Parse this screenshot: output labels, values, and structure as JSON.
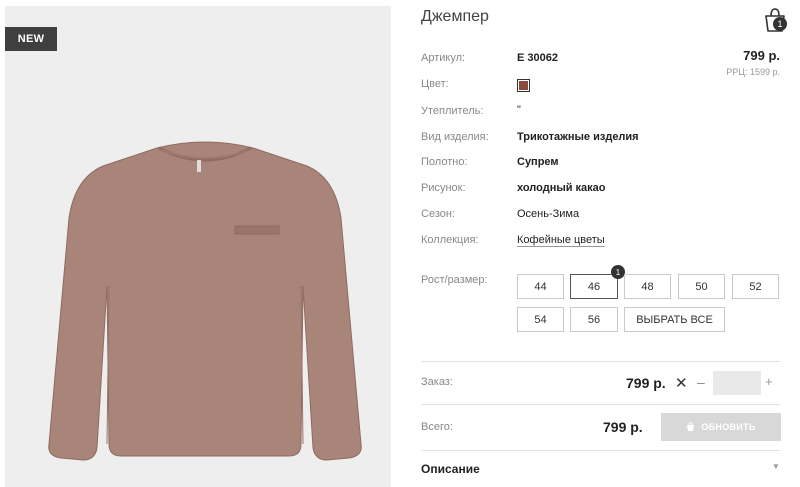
{
  "badge": {
    "new": "NEW"
  },
  "product": {
    "title": "Джемпер",
    "price": "799 р.",
    "rrp": "РРЦ: 1599 р.",
    "color_hex": "#8a4a3c"
  },
  "cart": {
    "count": "1"
  },
  "specs": {
    "article": {
      "label": "Артикул:",
      "value": "E 30062"
    },
    "color": {
      "label": "Цвет:"
    },
    "insulation": {
      "label": "Утеплитель:",
      "value": "\""
    },
    "type": {
      "label": "Вид изделия:",
      "value": "Трикотажные изделия"
    },
    "fabric": {
      "label": "Полотно:",
      "value": "Супрем"
    },
    "pattern": {
      "label": "Рисунок:",
      "value": "холодный какао"
    },
    "season": {
      "label": "Сезон:",
      "value": "Осень-Зима"
    },
    "collection": {
      "label": "Коллекция:",
      "value": "Кофейные цветы"
    }
  },
  "sizes": {
    "label": "Рост/размер:",
    "options": [
      "44",
      "46",
      "48",
      "50",
      "52",
      "54",
      "56"
    ],
    "select_all": "ВЫБРАТЬ ВСЕ",
    "selected_count": "1"
  },
  "order": {
    "label": "Заказ:",
    "price": "799 р.",
    "quantity": ""
  },
  "total": {
    "label": "Всего:",
    "price": "799 р.",
    "update_label": "ОБНОВИТЬ"
  },
  "description": {
    "label": "Описание"
  }
}
